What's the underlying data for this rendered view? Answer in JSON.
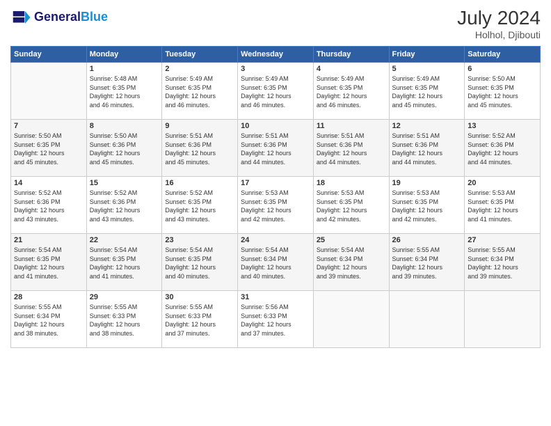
{
  "header": {
    "logo_line1": "General",
    "logo_line2": "Blue",
    "month_year": "July 2024",
    "location": "Holhol, Djibouti"
  },
  "weekdays": [
    "Sunday",
    "Monday",
    "Tuesday",
    "Wednesday",
    "Thursday",
    "Friday",
    "Saturday"
  ],
  "weeks": [
    [
      {
        "day": "",
        "info": ""
      },
      {
        "day": "1",
        "info": "Sunrise: 5:48 AM\nSunset: 6:35 PM\nDaylight: 12 hours\nand 46 minutes."
      },
      {
        "day": "2",
        "info": "Sunrise: 5:49 AM\nSunset: 6:35 PM\nDaylight: 12 hours\nand 46 minutes."
      },
      {
        "day": "3",
        "info": "Sunrise: 5:49 AM\nSunset: 6:35 PM\nDaylight: 12 hours\nand 46 minutes."
      },
      {
        "day": "4",
        "info": "Sunrise: 5:49 AM\nSunset: 6:35 PM\nDaylight: 12 hours\nand 46 minutes."
      },
      {
        "day": "5",
        "info": "Sunrise: 5:49 AM\nSunset: 6:35 PM\nDaylight: 12 hours\nand 45 minutes."
      },
      {
        "day": "6",
        "info": "Sunrise: 5:50 AM\nSunset: 6:35 PM\nDaylight: 12 hours\nand 45 minutes."
      }
    ],
    [
      {
        "day": "7",
        "info": "Sunrise: 5:50 AM\nSunset: 6:35 PM\nDaylight: 12 hours\nand 45 minutes."
      },
      {
        "day": "8",
        "info": "Sunrise: 5:50 AM\nSunset: 6:36 PM\nDaylight: 12 hours\nand 45 minutes."
      },
      {
        "day": "9",
        "info": "Sunrise: 5:51 AM\nSunset: 6:36 PM\nDaylight: 12 hours\nand 45 minutes."
      },
      {
        "day": "10",
        "info": "Sunrise: 5:51 AM\nSunset: 6:36 PM\nDaylight: 12 hours\nand 44 minutes."
      },
      {
        "day": "11",
        "info": "Sunrise: 5:51 AM\nSunset: 6:36 PM\nDaylight: 12 hours\nand 44 minutes."
      },
      {
        "day": "12",
        "info": "Sunrise: 5:51 AM\nSunset: 6:36 PM\nDaylight: 12 hours\nand 44 minutes."
      },
      {
        "day": "13",
        "info": "Sunrise: 5:52 AM\nSunset: 6:36 PM\nDaylight: 12 hours\nand 44 minutes."
      }
    ],
    [
      {
        "day": "14",
        "info": "Sunrise: 5:52 AM\nSunset: 6:36 PM\nDaylight: 12 hours\nand 43 minutes."
      },
      {
        "day": "15",
        "info": "Sunrise: 5:52 AM\nSunset: 6:36 PM\nDaylight: 12 hours\nand 43 minutes."
      },
      {
        "day": "16",
        "info": "Sunrise: 5:52 AM\nSunset: 6:35 PM\nDaylight: 12 hours\nand 43 minutes."
      },
      {
        "day": "17",
        "info": "Sunrise: 5:53 AM\nSunset: 6:35 PM\nDaylight: 12 hours\nand 42 minutes."
      },
      {
        "day": "18",
        "info": "Sunrise: 5:53 AM\nSunset: 6:35 PM\nDaylight: 12 hours\nand 42 minutes."
      },
      {
        "day": "19",
        "info": "Sunrise: 5:53 AM\nSunset: 6:35 PM\nDaylight: 12 hours\nand 42 minutes."
      },
      {
        "day": "20",
        "info": "Sunrise: 5:53 AM\nSunset: 6:35 PM\nDaylight: 12 hours\nand 41 minutes."
      }
    ],
    [
      {
        "day": "21",
        "info": "Sunrise: 5:54 AM\nSunset: 6:35 PM\nDaylight: 12 hours\nand 41 minutes."
      },
      {
        "day": "22",
        "info": "Sunrise: 5:54 AM\nSunset: 6:35 PM\nDaylight: 12 hours\nand 41 minutes."
      },
      {
        "day": "23",
        "info": "Sunrise: 5:54 AM\nSunset: 6:35 PM\nDaylight: 12 hours\nand 40 minutes."
      },
      {
        "day": "24",
        "info": "Sunrise: 5:54 AM\nSunset: 6:34 PM\nDaylight: 12 hours\nand 40 minutes."
      },
      {
        "day": "25",
        "info": "Sunrise: 5:54 AM\nSunset: 6:34 PM\nDaylight: 12 hours\nand 39 minutes."
      },
      {
        "day": "26",
        "info": "Sunrise: 5:55 AM\nSunset: 6:34 PM\nDaylight: 12 hours\nand 39 minutes."
      },
      {
        "day": "27",
        "info": "Sunrise: 5:55 AM\nSunset: 6:34 PM\nDaylight: 12 hours\nand 39 minutes."
      }
    ],
    [
      {
        "day": "28",
        "info": "Sunrise: 5:55 AM\nSunset: 6:34 PM\nDaylight: 12 hours\nand 38 minutes."
      },
      {
        "day": "29",
        "info": "Sunrise: 5:55 AM\nSunset: 6:33 PM\nDaylight: 12 hours\nand 38 minutes."
      },
      {
        "day": "30",
        "info": "Sunrise: 5:55 AM\nSunset: 6:33 PM\nDaylight: 12 hours\nand 37 minutes."
      },
      {
        "day": "31",
        "info": "Sunrise: 5:56 AM\nSunset: 6:33 PM\nDaylight: 12 hours\nand 37 minutes."
      },
      {
        "day": "",
        "info": ""
      },
      {
        "day": "",
        "info": ""
      },
      {
        "day": "",
        "info": ""
      }
    ]
  ]
}
